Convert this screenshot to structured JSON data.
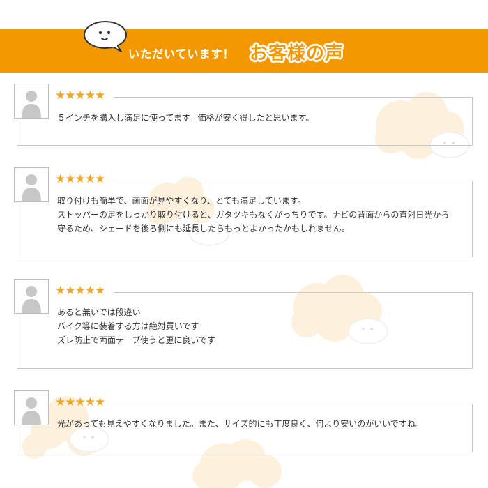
{
  "header": {
    "subtitle": "いただいています！",
    "title": "お客様の声",
    "banner_color": "#f39800",
    "mascot_icon": "speech-bubble-face-icon"
  },
  "reviews": [
    {
      "rating": 5,
      "stars": "★★★★★",
      "avatar_icon": "user-silhouette-icon",
      "lines": [
        "５インチを購入し満足に使ってます。価格が安く得したと思います。"
      ]
    },
    {
      "rating": 5,
      "stars": "★★★★★",
      "avatar_icon": "user-silhouette-icon",
      "lines": [
        "取り付けも簡単で、画面が見やすくなり、とても満足しています。",
        "ストッパーの足をしっかり取り付けると、ガタツキもなくがっちりです。ナビの背面からの直射日光から",
        "守るため、シェードを後ろ側にも延長したらもっとよかったかもしれません。"
      ]
    },
    {
      "rating": 5,
      "stars": "★★★★★",
      "avatar_icon": "user-silhouette-icon",
      "lines": [
        "あると無いでは段違い",
        "バイク等に装着する方は絶対買いです",
        "ズレ防止で両面テープ使うと更に良いです"
      ]
    },
    {
      "rating": 5,
      "stars": "★★★★★",
      "avatar_icon": "user-silhouette-icon",
      "lines": [
        "光があっても見えやすくなりました。また、サイズ的にも丁度良く、何より安いのがいいですね。"
      ]
    }
  ],
  "colors": {
    "star": "#f5a623",
    "cloud": "#fdf1de",
    "border": "#c8c8c8"
  }
}
